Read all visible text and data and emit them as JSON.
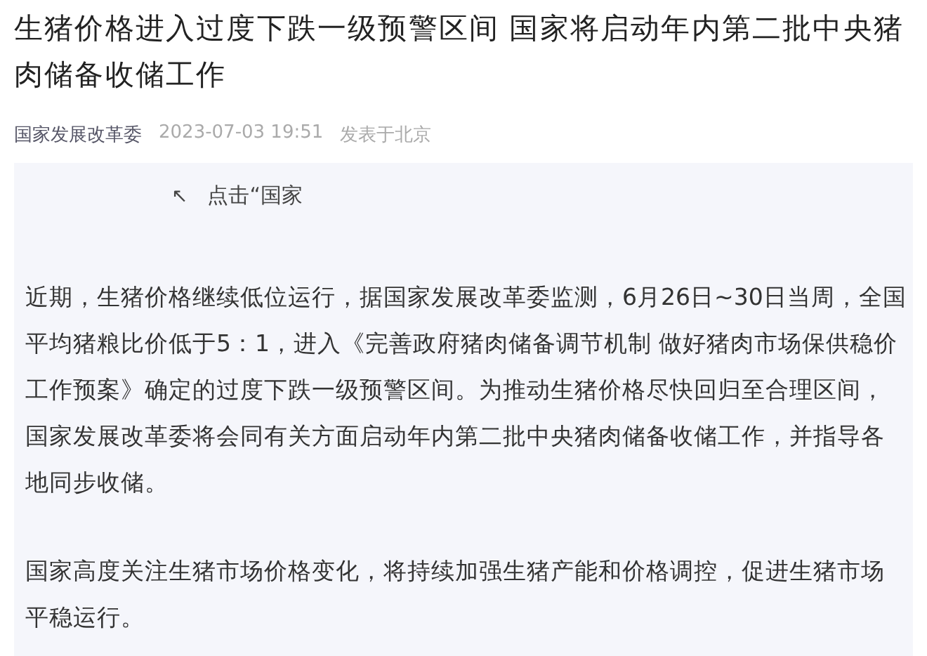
{
  "article": {
    "title": "生猪价格进入过度下跌一级预警区间 国家将启动年内第二批中央猪肉储备收储工作",
    "source": "国家发展改革委",
    "time": "2023-07-03 19:51",
    "location": "发表于北京"
  },
  "card": {
    "hint_icon": "↖",
    "hint": "点击“国家",
    "paragraphs": [
      "近期，生猪价格继续低位运行，据国家发展改革委监测，6月26日~30日当周，全国平均猪粮比价低于5：1，进入《完善政府猪肉储备调节机制 做好猪肉市场保供稳价工作预案》确定的过度下跌一级预警区间。为推动生猪价格尽快回归至合理区间，国家发展改革委将会同有关方面启动年内第二批中央猪肉储备收储工作，并指导各地同步收储。",
      "国家高度关注生猪市场价格变化，将持续加强生猪产能和价格调控，促进生猪市场平稳运行。"
    ]
  }
}
